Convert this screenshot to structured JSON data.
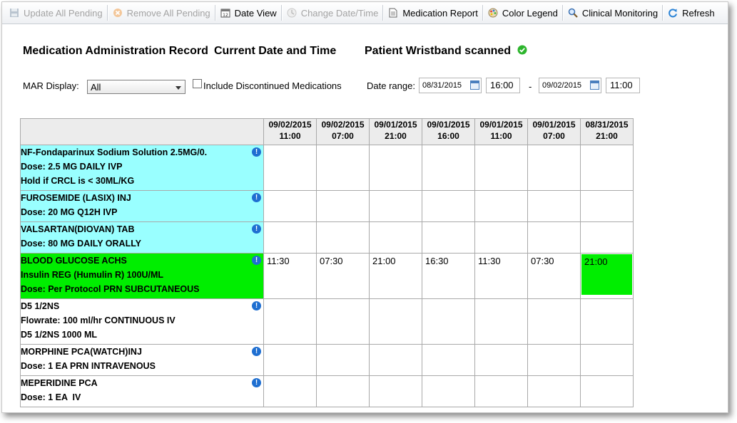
{
  "toolbar": {
    "update_all_pending": "Update All Pending",
    "remove_all_pending": "Remove All Pending",
    "date_view": "Date View",
    "change_date_time": "Change Date/Time",
    "medication_report": "Medication Report",
    "color_legend": "Color Legend",
    "clinical_monitoring": "Clinical Monitoring",
    "refresh": "Refresh"
  },
  "header": {
    "mar_title": "Medication Administration Record",
    "current_date_time": "Current Date and Time",
    "wristband": "Patient Wristband scanned"
  },
  "filters": {
    "mar_display_label": "MAR Display:",
    "mar_display_value": "All",
    "include_discontinued": "Include Discontinued Medications",
    "date_range_label": "Date range:",
    "start_date": "08/31/2015",
    "start_time": "16:00",
    "separator": "-",
    "end_date": "09/02/2015",
    "end_time": "11:00"
  },
  "columns": [
    {
      "date": "09/02/2015",
      "time": "11:00"
    },
    {
      "date": "09/02/2015",
      "time": "07:00"
    },
    {
      "date": "09/01/2015",
      "time": "21:00"
    },
    {
      "date": "09/01/2015",
      "time": "16:00"
    },
    {
      "date": "09/01/2015",
      "time": "11:00"
    },
    {
      "date": "09/01/2015",
      "time": "07:00"
    },
    {
      "date": "08/31/2015",
      "time": "21:00"
    }
  ],
  "medications": [
    {
      "color": "#99ffff",
      "lines": [
        "NF-Fondaparinux Sodium Solution 2.5MG/0.",
        "Dose: 2.5 MG DAILY IVP",
        "Hold if CRCL is < 30ML/KG"
      ],
      "cells": [
        "",
        "",
        "",
        "",
        "",
        "",
        ""
      ]
    },
    {
      "color": "#99ffff",
      "lines": [
        "FUROSEMIDE (LASIX) INJ",
        "Dose: 20 MG Q12H IVP"
      ],
      "cells": [
        "",
        "",
        "",
        "",
        "",
        "",
        ""
      ]
    },
    {
      "color": "#99ffff",
      "lines": [
        "VALSARTAN(DIOVAN) TAB",
        "Dose: 80 MG DAILY ORALLY"
      ],
      "cells": [
        "",
        "",
        "",
        "",
        "",
        "",
        ""
      ]
    },
    {
      "color": "#00ee00",
      "lines": [
        "BLOOD GLUCOSE ACHS",
        "Insulin REG (Humulin R) 100U/ML",
        "Dose: Per Protocol PRN SUBCUTANEOUS"
      ],
      "cells": [
        "11:30",
        "07:30",
        "21:00",
        "16:30",
        "11:30",
        "07:30",
        "21:00"
      ],
      "highlight_cell": 6
    },
    {
      "color": "#ffffff",
      "lines": [
        "D5 1/2NS",
        "Flowrate: 100 ml/hr CONTINUOUS IV",
        "D5 1/2NS 1000 ML"
      ],
      "cells": [
        "",
        "",
        "",
        "",
        "",
        "",
        ""
      ]
    },
    {
      "color": "#ffffff",
      "lines": [
        "MORPHINE PCA(WATCH)INJ",
        "Dose: 1 EA PRN INTRAVENOUS"
      ],
      "cells": [
        "",
        "",
        "",
        "",
        "",
        "",
        ""
      ]
    },
    {
      "color": "#ffffff",
      "lines": [
        "MEPERIDINE PCA",
        "Dose: 1 EA  IV"
      ],
      "cells": [
        "",
        "",
        "",
        "",
        "",
        "",
        ""
      ]
    }
  ],
  "colors": {
    "cyan": "#99ffff",
    "green": "#00ee00",
    "highlight": "#00ee00",
    "info_icon": "#1f6fd1",
    "check_icon": "#2db52d"
  }
}
